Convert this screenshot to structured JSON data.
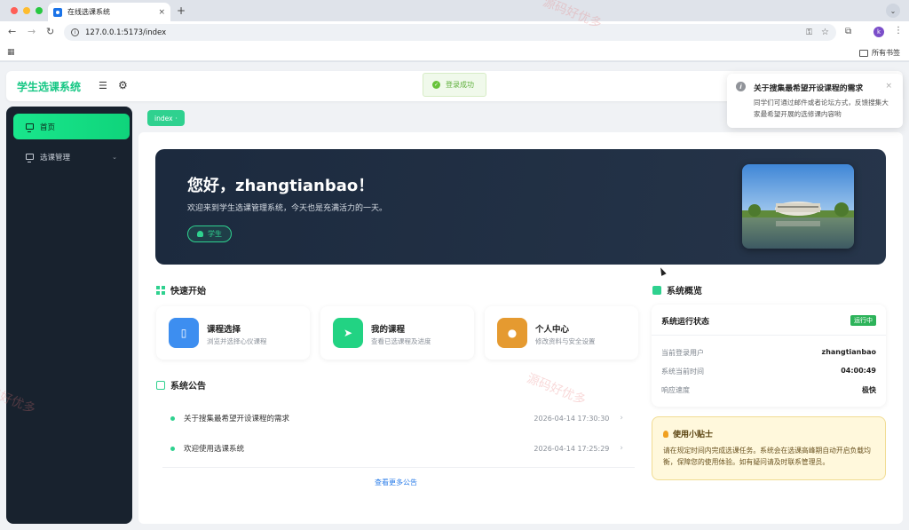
{
  "browser": {
    "tab_title": "在线选课系统",
    "tab_close": "×",
    "new_tab": "+",
    "url": "127.0.0.1:5173/index",
    "bookmarks_label": "所有书签",
    "profile_initial": "k"
  },
  "header": {
    "brand": "学生选课系统"
  },
  "sidebar": {
    "items": [
      {
        "label": "首页",
        "active": true
      },
      {
        "label": "选课管理",
        "active": false
      }
    ]
  },
  "breadcrumb": {
    "tag": "index"
  },
  "banner": {
    "greeting": "您好，zhangtianbao！",
    "welcome": "欢迎来到学生选课管理系统，今天也是充满活力的一天。",
    "role": "学生"
  },
  "quick": {
    "title": "快速开始",
    "cards": [
      {
        "title": "课程选择",
        "desc": "浏览并选择心仪课程",
        "color": "#3d8ef0"
      },
      {
        "title": "我的课程",
        "desc": "查看已选课程及进度",
        "color": "#22d383"
      },
      {
        "title": "个人中心",
        "desc": "修改资料与安全设置",
        "color": "#e59a30"
      }
    ]
  },
  "notices": {
    "title": "系统公告",
    "items": [
      {
        "title": "关于搜集最希望开设课程的需求",
        "time": "2026-04-14 17:30:30"
      },
      {
        "title": "欢迎使用选课系统",
        "time": "2026-04-14 17:25:29"
      }
    ],
    "more": "查看更多公告"
  },
  "overview": {
    "title": "系统概览",
    "card_title": "系统运行状态",
    "badge": "运行中",
    "rows": [
      {
        "key": "当前登录用户",
        "value": "zhangtianbao"
      },
      {
        "key": "系统当前时间",
        "value": "04:00:49"
      },
      {
        "key": "响应速度",
        "value": "极快"
      }
    ]
  },
  "tips": {
    "title": "使用小贴士",
    "text": "请在规定时间内完成选课任务。系统会在选课高峰期自动开启负载均衡，保障您的使用体验。如有疑问请及时联系管理员。"
  },
  "toast": {
    "text": "登录成功"
  },
  "notification": {
    "title": "关于搜集最希望开设课程的需求",
    "body": "同学们可通过邮件或者论坛方式，反馈搜集大家最希望开展的选修课内容哟"
  },
  "watermark": "源码好优多",
  "colors": {
    "accent": "#2fd18f",
    "banner": "#1c2a3e",
    "sidebar": "#18222e"
  }
}
